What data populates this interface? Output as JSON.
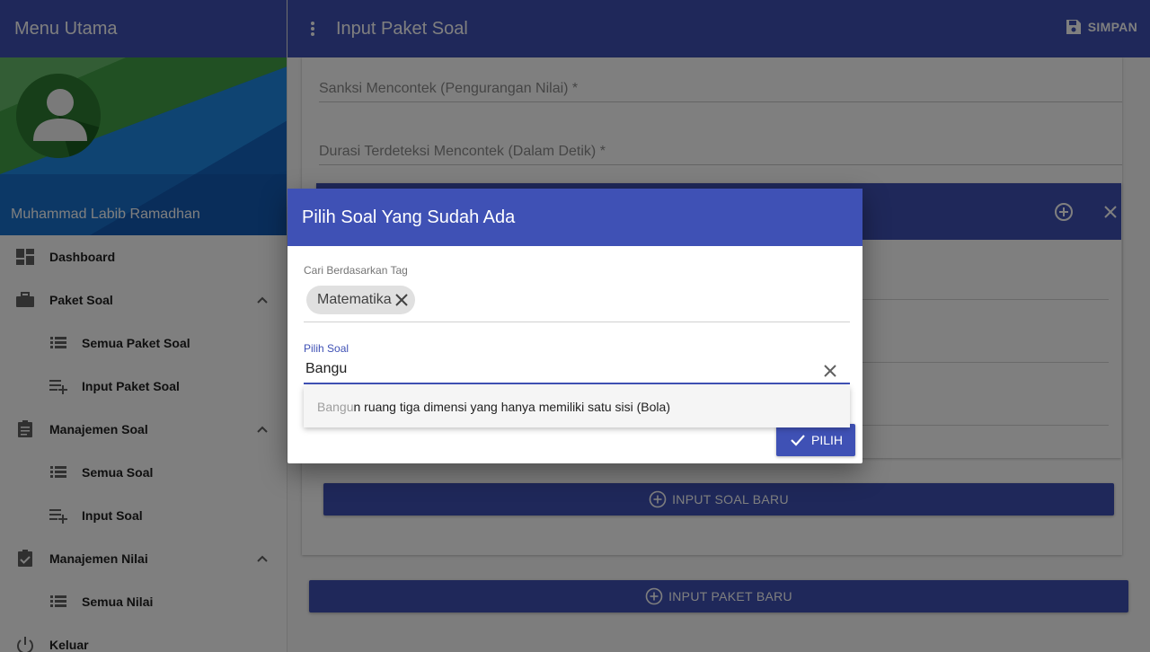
{
  "sidebar": {
    "title": "Menu Utama",
    "user_name": "Muhammad Labib Ramadhan",
    "items": [
      {
        "label": "Dashboard"
      },
      {
        "label": "Paket Soal"
      },
      {
        "label": "Semua Paket Soal"
      },
      {
        "label": "Input Paket Soal"
      },
      {
        "label": "Manajemen Soal"
      },
      {
        "label": "Semua Soal"
      },
      {
        "label": "Input Soal"
      },
      {
        "label": "Manajemen Nilai"
      },
      {
        "label": "Semua Nilai"
      },
      {
        "label": "Keluar"
      }
    ]
  },
  "topbar": {
    "title": "Input Paket Soal",
    "save_label": "SIMPAN"
  },
  "form": {
    "sanksi_label": "Sanksi Mencontek (Pengurangan Nilai) *",
    "durasi_label": "Durasi Terdeteksi Mencontek (Dalam Detik) *",
    "input_soal_baru": "INPUT SOAL BARU",
    "input_paket_baru": "INPUT PAKET BARU"
  },
  "dialog": {
    "title": "Pilih Soal Yang Sudah Ada",
    "tag_label": "Cari Berdasarkan Tag",
    "tag_chip": "Matematika",
    "soal_label": "Pilih Soal",
    "soal_value": "Bangu",
    "suggestion_match": "Bangu",
    "suggestion_rest": "n ruang tiga dimensi yang hanya memiliki satu sisi (Bola)",
    "pilih_label": "PILIH"
  },
  "colors": {
    "primary": "#3f51b5",
    "overlay": "rgba(0,0,0,0.5)"
  }
}
